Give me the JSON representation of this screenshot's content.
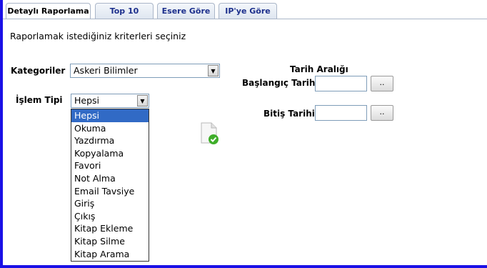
{
  "tabs": [
    {
      "label": "Detaylı Raporlama",
      "active": true
    },
    {
      "label": "Top 10",
      "active": false
    },
    {
      "label": "Esere Göre",
      "active": false
    },
    {
      "label": "IP'ye Göre",
      "active": false
    }
  ],
  "intro_text": "Raporlamak istediğiniz kriterleri seçiniz",
  "kategoriler": {
    "label": "Kategoriler",
    "selected": "Askeri Bilimler"
  },
  "islem_tipi": {
    "label": "İşlem Tipi",
    "selected": "Hepsi",
    "options": [
      "Hepsi",
      "Okuma",
      "Yazdırma",
      "Kopyalama",
      "Favori",
      "Not Alma",
      "Email Tavsiye",
      "Giriş",
      "Çıkış",
      "Kitap Ekleme",
      "Kitap Silme",
      "Kitap Arama"
    ]
  },
  "tarih": {
    "heading": "Tarih Aralığı",
    "baslangic_label": "Başlangıç Tarihi",
    "bitis_label": "Bitiş Tarihi",
    "picker_label": ".."
  },
  "colors": {
    "frame": "#1a10e6",
    "selection": "#316ac5",
    "tab_text": "#1c2f8c",
    "check": "#3fae2a"
  },
  "icons": {
    "report": "document-check-icon"
  }
}
